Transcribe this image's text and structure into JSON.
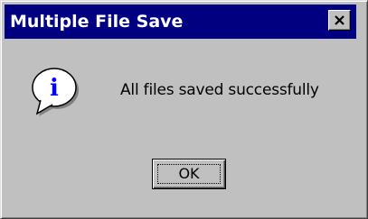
{
  "window": {
    "title": "Multiple File Save",
    "close_icon": "close-icon",
    "titlebar_color": "#000080",
    "face_color": "#c0c0c0"
  },
  "dialog": {
    "icon": "info-icon",
    "icon_glyph": "i",
    "message": "All files saved successfully",
    "ok_label": "OK"
  }
}
